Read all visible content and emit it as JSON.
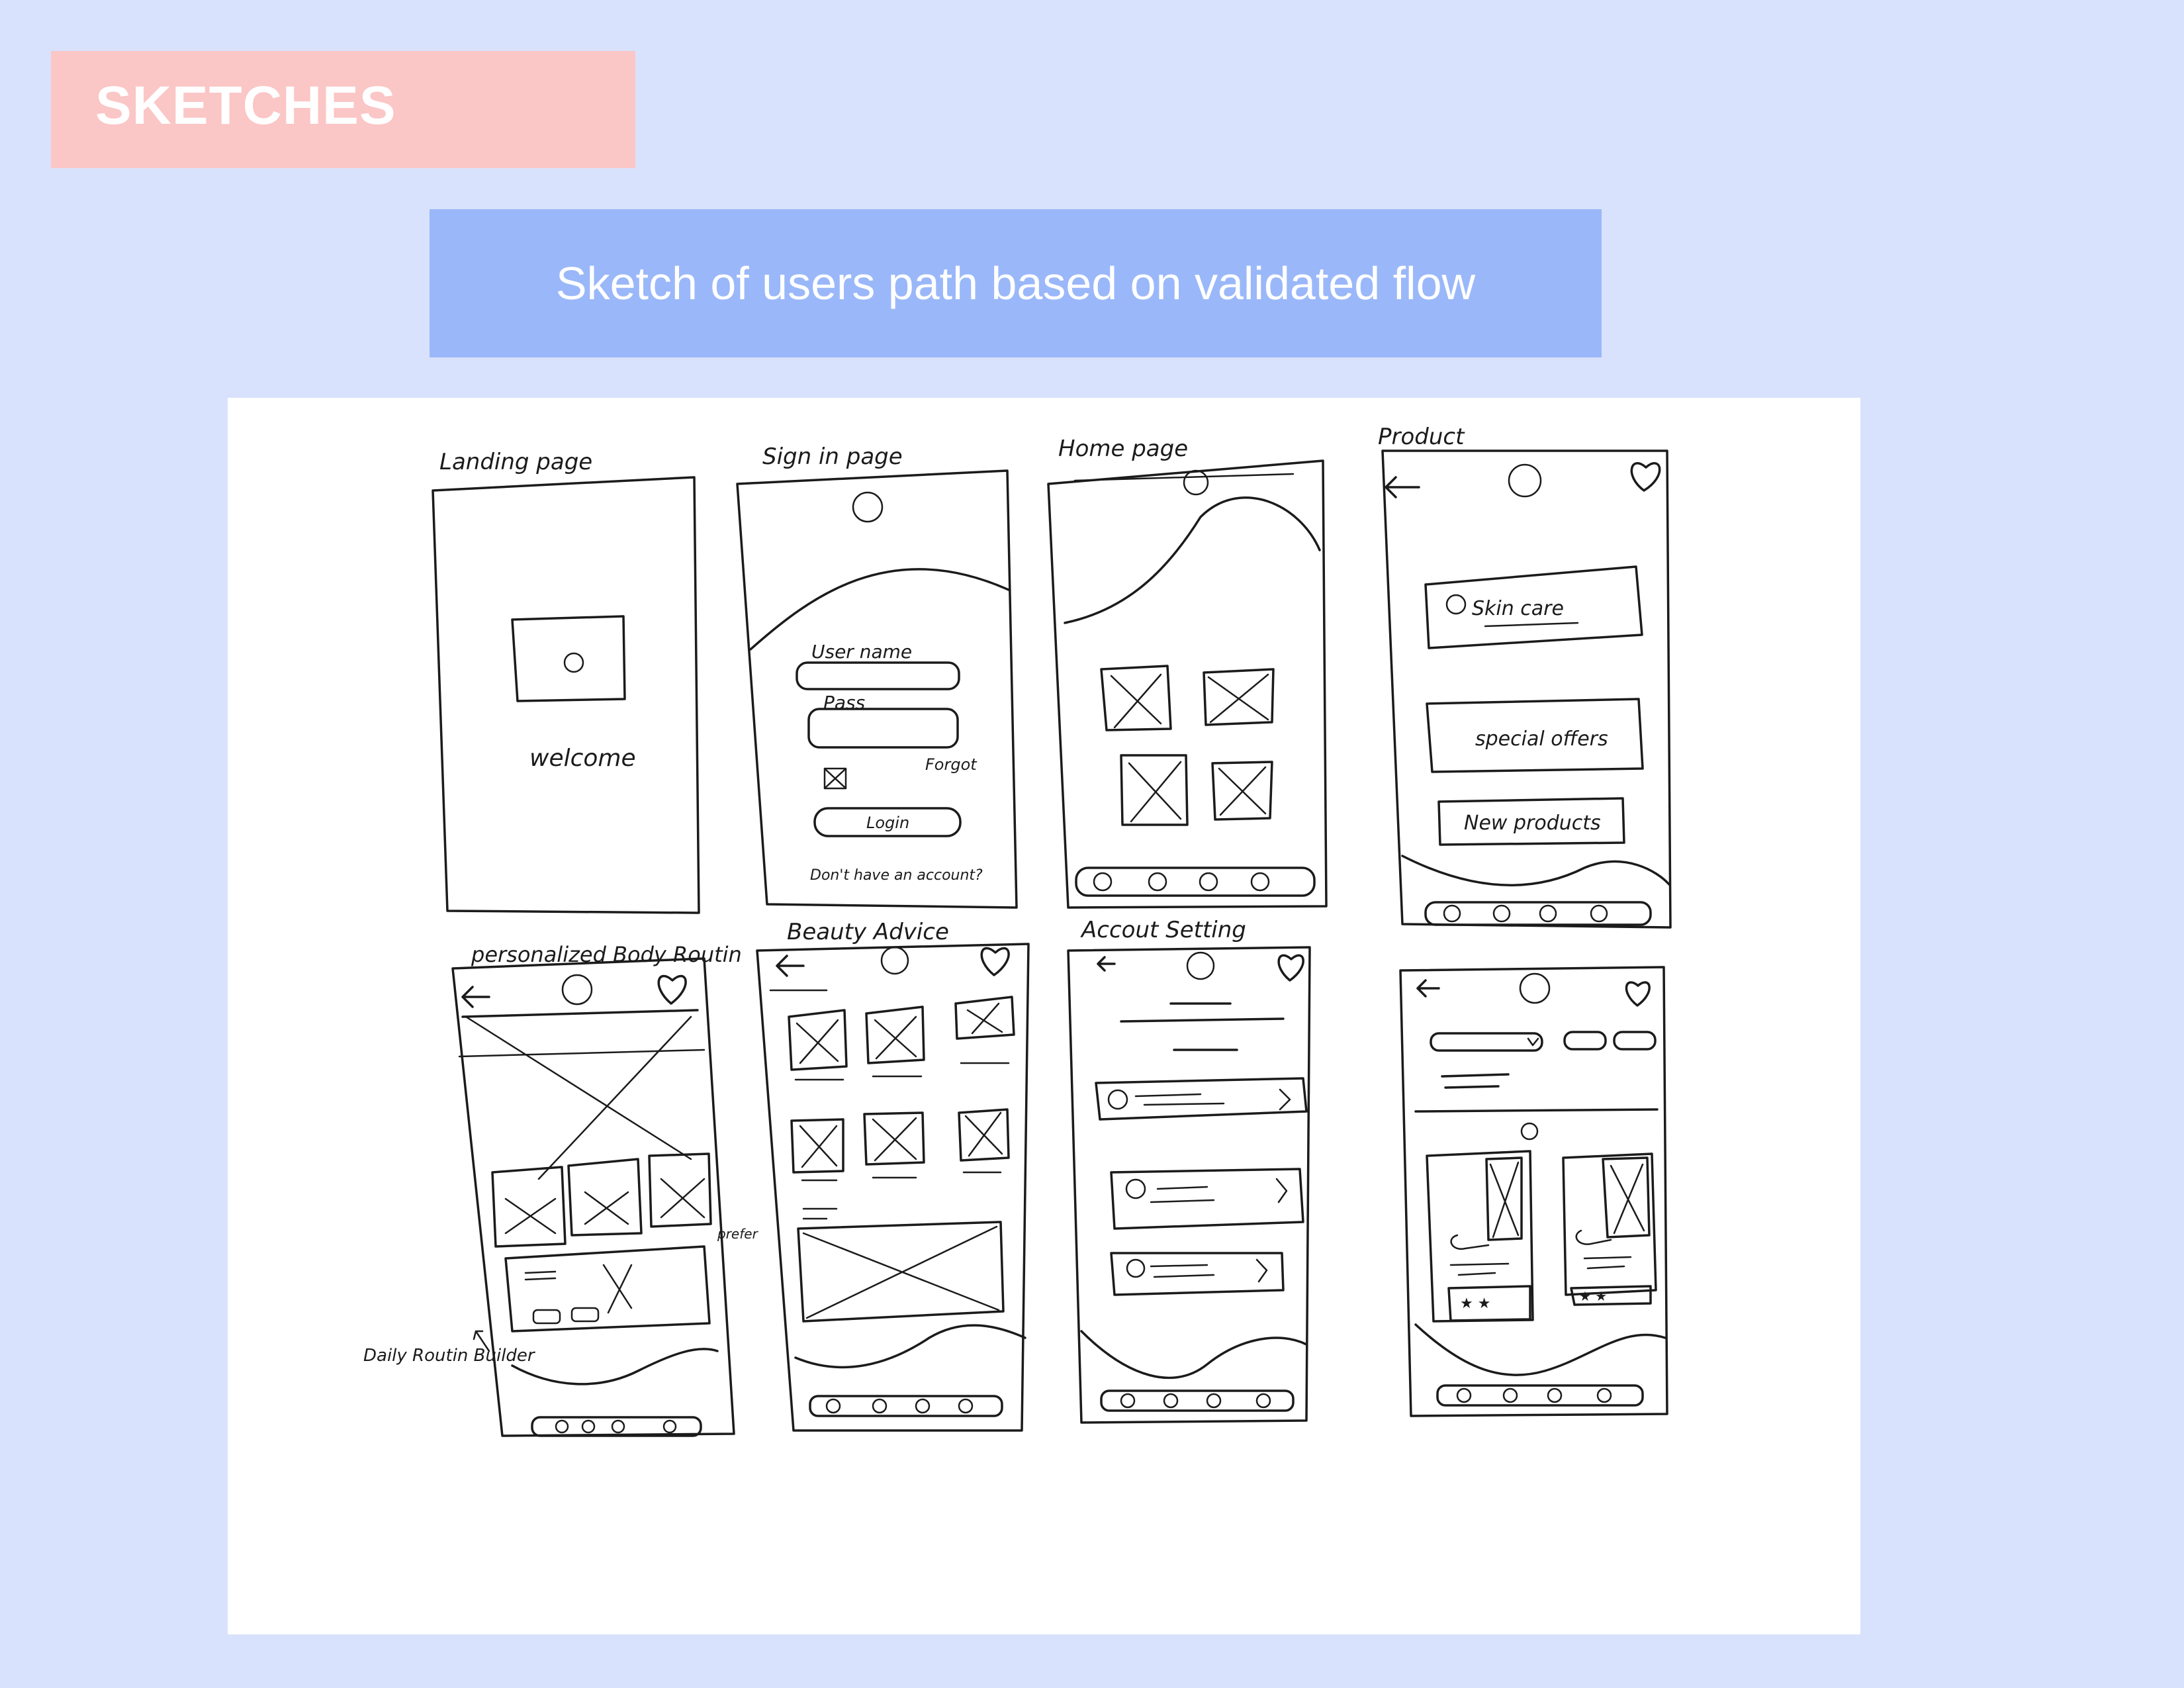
{
  "header": {
    "title": "SKETCHES",
    "subtitle": "Sketch of users path based on validated flow"
  },
  "colors": {
    "background": "#d9e2fc",
    "title_box": "#fbc6c6",
    "subtitle_box": "#9ab8f9",
    "sketch_ink": "#1b1b1b"
  },
  "sketches": {
    "landing": {
      "label": "Landing page",
      "welcome": "welcome"
    },
    "signin": {
      "label": "Sign in page",
      "username": "User name",
      "password": "Pass",
      "forgot": "Forgot",
      "login": "Login",
      "no_account": "Don't have an account?"
    },
    "home": {
      "label": "Home page"
    },
    "product": {
      "label": "Product",
      "skin_care": "Skin care",
      "special_offers": "special offers",
      "new_products": "New products"
    },
    "routine": {
      "label": "personalized Body Routin",
      "annotation_daily": "Daily Routin Builder",
      "annotation_prefer": "prefer"
    },
    "advice": {
      "label": "Beauty Advice"
    },
    "account": {
      "label": "Accout Setting"
    },
    "products_list": {
      "label": ""
    }
  }
}
